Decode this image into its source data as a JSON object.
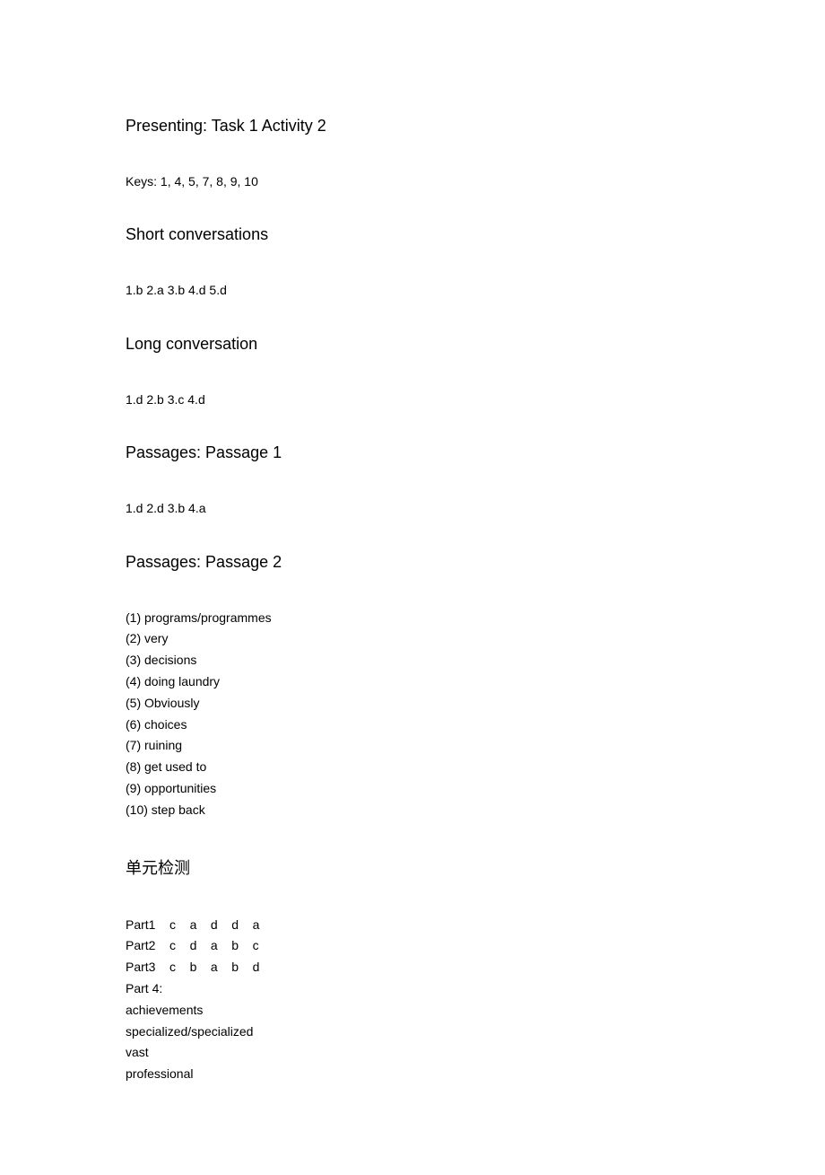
{
  "sections": {
    "presenting": {
      "heading": "Presenting: Task 1 Activity 2",
      "keys": "Keys: 1, 4, 5, 7, 8, 9, 10"
    },
    "shortConversations": {
      "heading": "Short conversations",
      "answers": "1.b    2.a    3.b    4.d    5.d"
    },
    "longConversation": {
      "heading": "Long conversation",
      "answers": "1.d    2.b    3.c    4.d"
    },
    "passage1": {
      "heading": "Passages: Passage 1",
      "answers": "1.d    2.d    3.b    4.a"
    },
    "passage2": {
      "heading": "Passages: Passage 2",
      "items": [
        "(1) programs/programmes",
        "(2) very",
        "(3) decisions",
        "(4) doing laundry",
        "(5) Obviously",
        "(6) choices",
        "(7) ruining",
        "(8) get used to",
        "(9) opportunities",
        "(10) step back"
      ]
    },
    "unitTest": {
      "heading": "单元检测",
      "parts": [
        "Part1    c    a    d    d    a",
        "Part2    c    d    a    b    c",
        "Part3    c    b    a    b    d",
        "Part 4:",
        "achievements",
        "specialized/specialized",
        "vast",
        "professional"
      ]
    }
  }
}
